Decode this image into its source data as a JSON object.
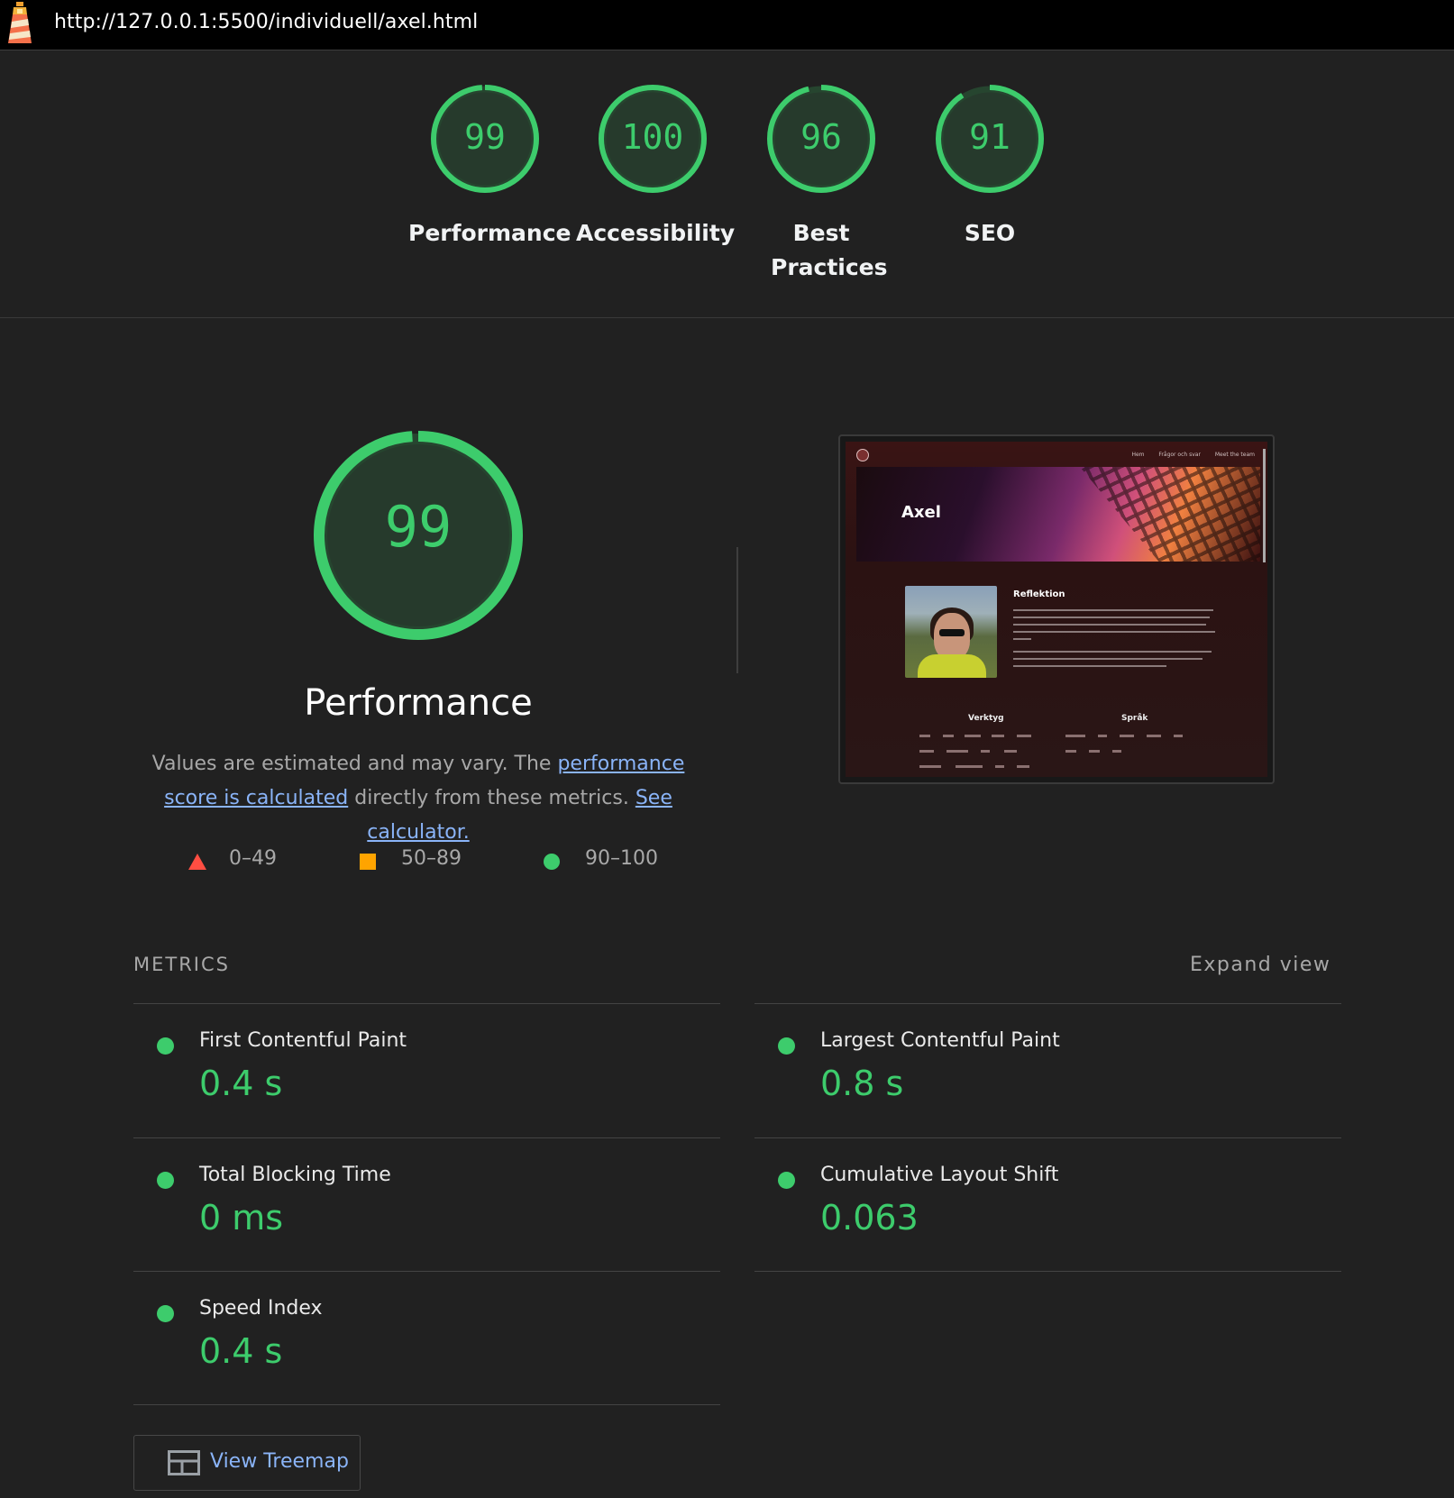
{
  "topbar": {
    "url": "http://127.0.0.1:5500/individuell/axel.html"
  },
  "colors": {
    "pass": "#3dcc6c",
    "average": "#ffa400",
    "fail": "#ff4e42",
    "link": "#8ab4f8",
    "background": "#212121"
  },
  "categories": [
    {
      "score": "99",
      "value": 0.99,
      "label": "Performance"
    },
    {
      "score": "100",
      "value": 1.0,
      "label": "Accessibility"
    },
    {
      "score": "96",
      "value": 0.96,
      "label": "Best Practices"
    },
    {
      "score": "91",
      "value": 0.91,
      "label": "SEO"
    }
  ],
  "performance": {
    "score": "99",
    "value": 0.99,
    "title": "Performance",
    "desc_prefix": "Values are estimated and may vary. The ",
    "desc_link1": "performance score is calculated",
    "desc_middle": " directly from these metrics. ",
    "desc_link2": "See calculator."
  },
  "legend": {
    "fail": "0–49",
    "average": "50–89",
    "pass": "90–100"
  },
  "screenshot": {
    "nav": [
      "Hem",
      "Frågor och svar",
      "Meet the team"
    ],
    "hero_name": "Axel",
    "section_title": "Reflektion",
    "col1_title": "Verktyg",
    "col2_title": "Språk"
  },
  "metrics": {
    "heading": "METRICS",
    "expand_label": "Expand view",
    "items": [
      {
        "title": "First Contentful Paint",
        "value": "0.4 s"
      },
      {
        "title": "Largest Contentful Paint",
        "value": "0.8 s"
      },
      {
        "title": "Total Blocking Time",
        "value": "0 ms"
      },
      {
        "title": "Cumulative Layout Shift",
        "value": "0.063"
      },
      {
        "title": "Speed Index",
        "value": "0.4 s"
      }
    ]
  },
  "treemap": {
    "label": "View Treemap",
    "icon": "treemap-icon"
  }
}
